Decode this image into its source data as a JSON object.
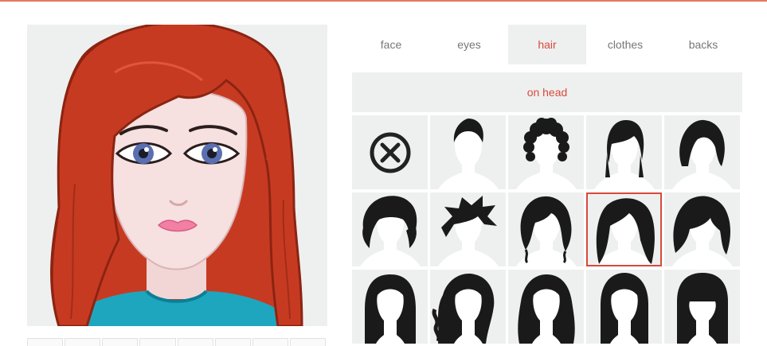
{
  "tabs": [
    {
      "label": "face",
      "active": false
    },
    {
      "label": "eyes",
      "active": false
    },
    {
      "label": "hair",
      "active": true
    },
    {
      "label": "clothes",
      "active": false
    },
    {
      "label": "backs",
      "active": false
    }
  ],
  "subcategory": {
    "label": "on head"
  },
  "hair_options": [
    {
      "icon": "remove-icon",
      "selected": false
    },
    {
      "icon": "short-hair-icon",
      "selected": false
    },
    {
      "icon": "afro-hair-icon",
      "selected": false
    },
    {
      "icon": "side-part-hair-icon",
      "selected": false
    },
    {
      "icon": "bob-hair-icon",
      "selected": false
    },
    {
      "icon": "wavy-short-hair-icon",
      "selected": false
    },
    {
      "icon": "spiky-hair-icon",
      "selected": false
    },
    {
      "icon": "curly-bob-hair-icon",
      "selected": false
    },
    {
      "icon": "shoulder-length-hair-icon",
      "selected": true
    },
    {
      "icon": "bangs-bob-hair-icon",
      "selected": false
    },
    {
      "icon": "long-straight-hair-icon",
      "selected": false
    },
    {
      "icon": "long-curly-hair-icon",
      "selected": false
    },
    {
      "icon": "long-wavy-hair-icon",
      "selected": false
    },
    {
      "icon": "long-center-part-hair-icon",
      "selected": false
    },
    {
      "icon": "long-bangs-hair-icon",
      "selected": false
    }
  ],
  "colors": {
    "accent": "#d9493a",
    "panel_bg": "#eef0f0",
    "hair_red": "#c73a22",
    "shirt_teal": "#1ea6bf"
  }
}
